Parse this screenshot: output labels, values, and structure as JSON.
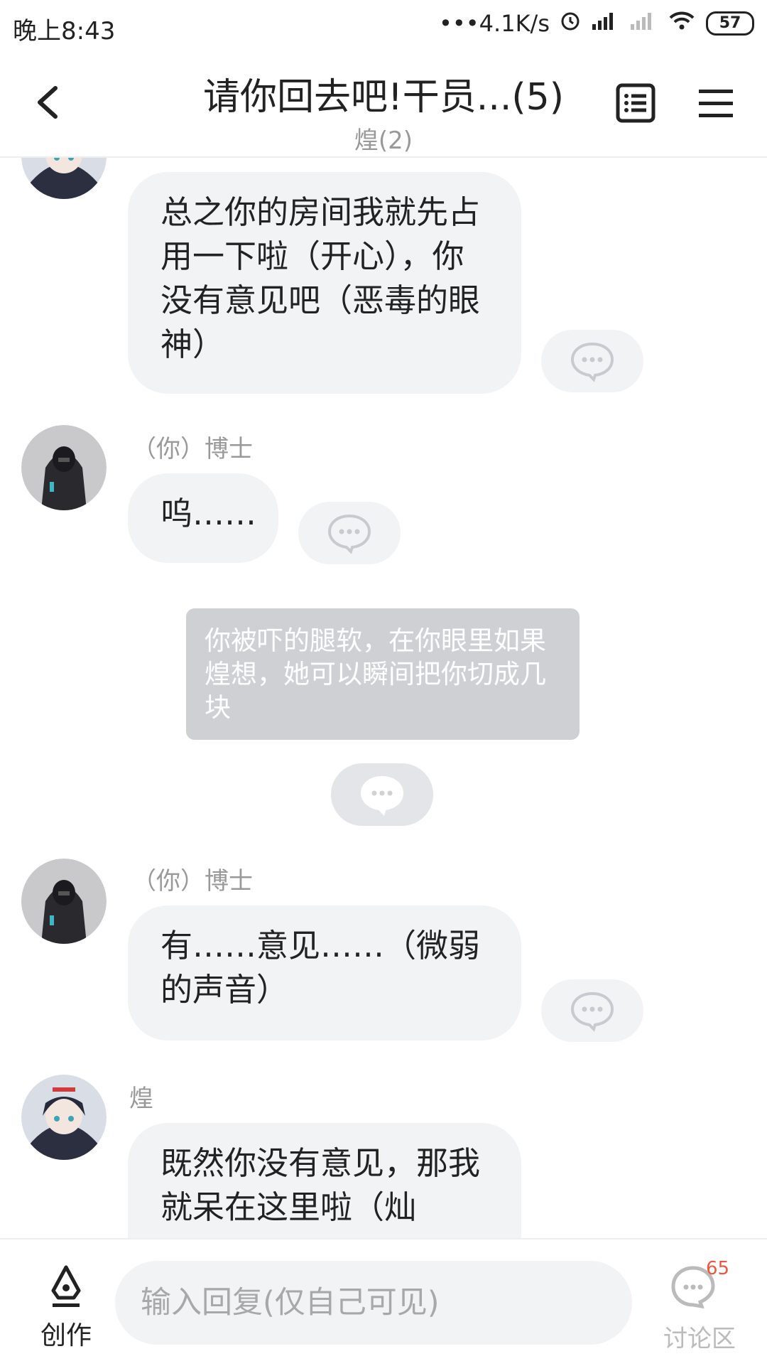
{
  "status_bar": {
    "time": "晚上8:43",
    "network_speed": "•••4.1K/s",
    "battery": "57"
  },
  "header": {
    "title": "请你回去吧!干员...(5)",
    "subtitle": "煌(2)"
  },
  "messages": [
    {
      "sender": "",
      "text": "总之你的房间我就先占用一下啦（开心），你没有意见吧（恶毒的眼神）"
    },
    {
      "sender": "（你）博士",
      "text": "呜……"
    },
    {
      "narration": "你被吓的腿软，在你眼里如果煌想，她可以瞬间把你切成几块"
    },
    {
      "sender": "（你）博士",
      "text": "有……意见……（微弱的声音）"
    },
    {
      "sender": "煌",
      "text": "既然你没有意见，那我就呆在这里啦（灿"
    }
  ],
  "bottom_bar": {
    "create_label": "创作",
    "reply_placeholder": "输入回复(仅自己可见)",
    "discuss_label": "讨论区",
    "discuss_count": "65"
  },
  "colors": {
    "bubble": "#f2f3f5",
    "narration": "#cfd0d4",
    "badge": "#f0563f"
  }
}
